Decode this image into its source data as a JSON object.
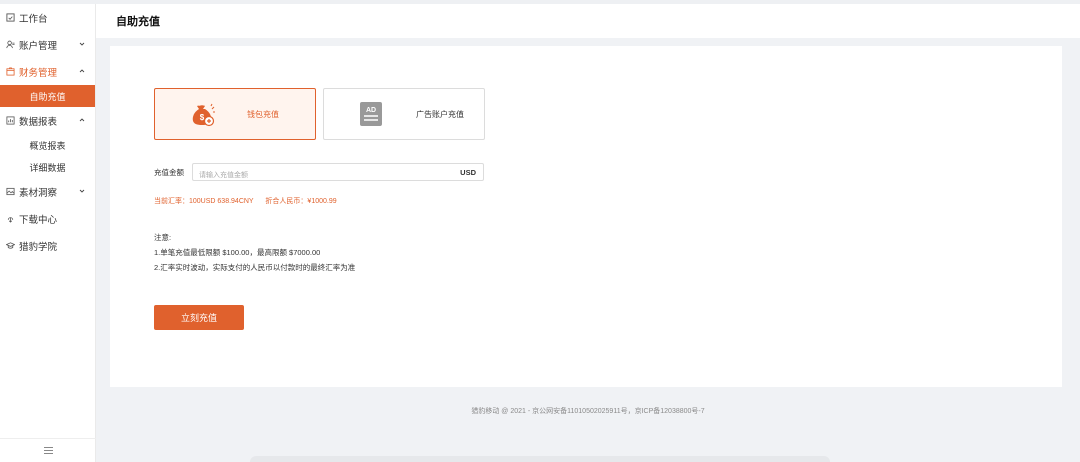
{
  "sidebar": {
    "items": [
      {
        "label": "工作台",
        "icon": "dashboard-icon"
      },
      {
        "label": "账户管理",
        "icon": "user-icon"
      },
      {
        "label": "财务管理",
        "icon": "finance-icon"
      },
      {
        "label": "数据报表",
        "icon": "report-icon"
      },
      {
        "label": "素材洞察",
        "icon": "image-icon"
      },
      {
        "label": "下载中心",
        "icon": "download-icon"
      },
      {
        "label": "猎豹学院",
        "icon": "academy-icon"
      }
    ],
    "finance_sub": [
      "自助充值"
    ],
    "report_sub": [
      "概览报表",
      "详细数据"
    ],
    "collapse_icon": "menu-icon"
  },
  "header": {
    "title": "自助充值"
  },
  "cards": {
    "wallet": {
      "label": "钱包充值",
      "icon": "money-bag-icon"
    },
    "ad": {
      "label": "广告账户充值",
      "icon": "ad-icon",
      "icon_text": "AD"
    }
  },
  "form": {
    "amount_label": "充值金额",
    "amount_placeholder": "请输入充值金额",
    "amount_value": "",
    "unit": "USD"
  },
  "rate": {
    "current": "当前汇率：100USD 638.94CNY",
    "rmb": "折合人民币：¥1000.99"
  },
  "notes": {
    "title": "注意:",
    "line1": "1.单笔充值最低限额 $100.00，最高限额 $7000.00",
    "line2": "2.汇率实时波动，实际支付的人民币以付款时的最终汇率为准"
  },
  "submit_label": "立刻充值",
  "footer": "猎豹移动 @ 2021 - 京公网安备11010502025911号，京ICP备12038800号-7",
  "colors": {
    "accent": "#e0612d",
    "accent_bg": "#fff4ee"
  }
}
